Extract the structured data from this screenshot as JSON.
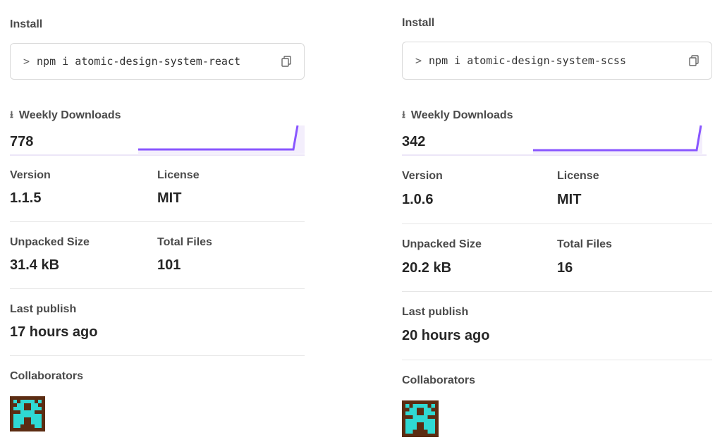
{
  "panels": [
    {
      "install_label": "Install",
      "install_prompt": ">",
      "install_command": "npm i atomic-design-system-react",
      "weekly_downloads_label": "Weekly Downloads",
      "weekly_downloads": "778",
      "version_label": "Version",
      "version": "1.1.5",
      "license_label": "License",
      "license": "MIT",
      "unpacked_size_label": "Unpacked Size",
      "unpacked_size": "31.4 kB",
      "total_files_label": "Total Files",
      "total_files": "101",
      "last_publish_label": "Last publish",
      "last_publish": "17 hours ago",
      "collaborators_label": "Collaborators"
    },
    {
      "install_label": "Install",
      "install_prompt": ">",
      "install_command": "npm i atomic-design-system-scss",
      "weekly_downloads_label": "Weekly Downloads",
      "weekly_downloads": "342",
      "version_label": "Version",
      "version": "1.0.6",
      "license_label": "License",
      "license": "MIT",
      "unpacked_size_label": "Unpacked Size",
      "unpacked_size": "20.2 kB",
      "total_files_label": "Total Files",
      "total_files": "16",
      "last_publish_label": "Last publish",
      "last_publish": "20 hours ago",
      "collaborators_label": "Collaborators"
    }
  ],
  "icons": {
    "copy": "copy-icon",
    "download": "download-icon",
    "avatar": "collaborator-avatar"
  },
  "colors": {
    "sparkline": "#8956ff",
    "sparkline_fill": "#ece6f8",
    "avatar_bg": "#5c2c12",
    "avatar_fg": "#2fd9d3"
  }
}
